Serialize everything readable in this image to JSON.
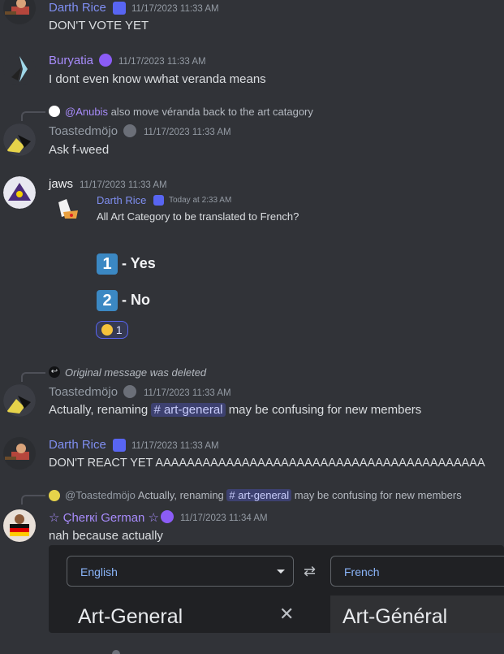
{
  "messages": [
    {
      "author": "Darth Rice",
      "timestamp": "11/17/2023 11:33 AM",
      "text": "DON'T VOTE YET"
    },
    {
      "author": "Buryatia",
      "timestamp": "11/17/2023 11:33 AM",
      "text": "I dont even know wwhat veranda means"
    },
    {
      "reply_mention": "@Anubis",
      "reply_text": "also move véranda back to the art catagory",
      "author": "Toastedmöjo",
      "timestamp": "11/17/2023 11:33 AM",
      "text": "Ask f-weed"
    },
    {
      "author": "jaws",
      "timestamp": "11/17/2023 11:33 AM",
      "forward": {
        "author": "Darth Rice",
        "timestamp": "Today at 2:33 AM",
        "text": "All Art Category to be translated to French?",
        "option1_key": "1",
        "option1": "- Yes",
        "option2_key": "2",
        "option2": "- No",
        "reaction_count": "1"
      }
    },
    {
      "reply_text": "Original message was deleted",
      "author": "Toastedmöjo",
      "timestamp": "11/17/2023 11:33 AM",
      "text_before": "Actually, renaming",
      "channel": "# art-general",
      "text_after": "may be confusing for new members"
    },
    {
      "author": "Darth Rice",
      "timestamp": "11/17/2023 11:33 AM",
      "text": "DON'T REACT YET AAAAAAAAAAAAAAAAAAAAAAAAAAAAAAAAAAAAAAAAAA"
    },
    {
      "reply_author": "@Toastedmöjo",
      "reply_text_before": "Actually, renaming",
      "reply_channel": "# art-general",
      "reply_text_after": "may be confusing for new members",
      "author": "☆ Çherкi German ☆",
      "timestamp": "11/17/2023 11:34 AM",
      "text": "nah because actually"
    }
  ],
  "translate": {
    "source_lang": "English",
    "target_lang": "French",
    "source_text": "Art-General",
    "target_text": "Art-Général"
  },
  "colors": {
    "background": "#313338",
    "accent": "#5865f2"
  }
}
